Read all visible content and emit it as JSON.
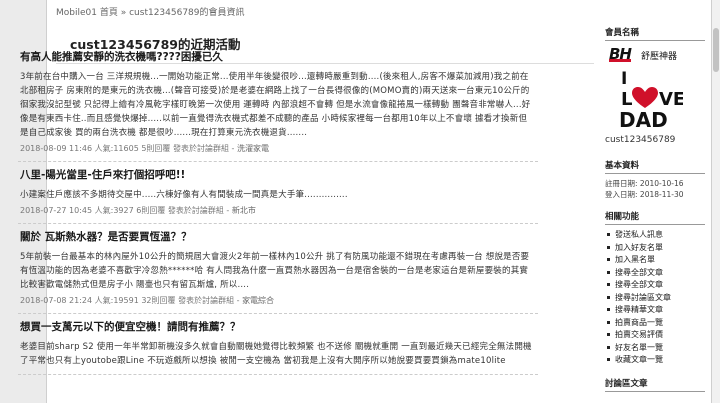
{
  "breadcrumb": {
    "home": "Mobile01 首頁",
    "sep": "»",
    "current": "cust123456789的會員資訊"
  },
  "page_title": "cust123456789的近期活動",
  "posts": [
    {
      "title": "有高人能推薦安靜的洗衣機嗎????困擾已久",
      "excerpt": "3年前在台中購入一台 三洋規規機...一開始功能正常...使用半年後變很吵...還轉時嚴重到動....(後來租人,房客不爆菜加減用)我之前在北部租房子 房東附的是東元的洗衣機...(聲音可接受)於是老婆在網路上找了一台長得很像的(MOMO賣的)兩天送來一台東元10公斤的徊家我沒記型號 只記得上繪有冷風乾字樣盯晚第一次使用 運轉時 內部浪超不會轉 但是水流會像龍捲風一樣轉動 團聲音非常嚇人...好像是有東西卡住..而且感覺快爆掉.....以前一直覺得洗衣機式都差不成聽的產品 小時候家裡每一台都用10年以上不會壞 據看才換新但是自己成家後 買的兩台洗衣機 都是很吵......現在打算東元洗衣機退貨.......",
      "date": "2018-08-09 11:46",
      "views": "人氣:11605",
      "replies": "5則回覆",
      "board_prefix": "發表於討論群組 -",
      "board": "洗濯家電"
    },
    {
      "title": "八里-陽光當里-住戶來打個招呼吧!!",
      "excerpt": "小建案住戶應該不多期待交屋中.....六棟好像有人有間裝成一間真是大手筆...............",
      "date": "2018-07-27 10:45",
      "views": "人氣:3927",
      "replies": "6則回覆",
      "board_prefix": "發表於討論群組 -",
      "board": "新北市"
    },
    {
      "title": "關於 瓦斯熱水器？是否要買恆溫？？",
      "excerpt": "5年前裝一台最基本的林內屋外10公升的簡規屆大會渡火2年前一樣林內10公升 挑了有防風功能還不錯現在考慮再裝一台 想說是否要有恆溫功能的因為老婆不喜歡宇冷忽熱******哈 有人問我為什麼一直買熱水器因為一台是宿舍裝的一台是老家這台是新屋要裝的其實比較害歡電儲熱式但是房子小 陽臺也只有留瓦斯爐, 所以....",
      "date": "2018-07-08 21:24",
      "views": "人氣:19591",
      "replies": "32則回覆",
      "board_prefix": "發表於討論群組 -",
      "board": "家電綜合"
    },
    {
      "title": "想買一支萬元以下的便宜空機！請問有推薦？？",
      "excerpt": "老婆目前sharp S2 使用一年半常卸新機沒多久就會自動關機她覺得比較頻繁 也不送修 關機就重開 一直到最近幾天已經完全無法開機了平常也只有上youtobe跟Line 不玩遊戲所以想換 被閒一支空機為 當初我是上沒有大開序所以她說要買要買鎖為mate10lite",
      "date": "",
      "views": "",
      "replies": "",
      "board_prefix": "",
      "board": ""
    }
  ],
  "sidebar": {
    "member_heading": "會員名稱",
    "logo": {
      "brand": "BH",
      "tagline": "舒壓神器",
      "line1": "I",
      "line2": "LOVE",
      "line3": "DAD"
    },
    "username": "cust123456789",
    "basic_heading": "基本資料",
    "register_label": "註冊日期:",
    "register_date": "2010-10-16",
    "login_label": "登入日期:",
    "login_date": "2018-11-30",
    "functions_heading": "相關功能",
    "functions": [
      "發送私人訊息",
      "加入好友名單",
      "加入黑名單",
      "搜尋全部文章",
      "搜尋全部文章",
      "搜尋討論區文章",
      "搜尋精華文章",
      "拍賣商品一覽",
      "拍賣交易評價",
      "好友名單一覽",
      "收藏文章一覽"
    ],
    "bottom_heading": "討論區文章"
  },
  "colors": {
    "accent_red": "#d0102a",
    "page_bg": "#ebebeb"
  }
}
